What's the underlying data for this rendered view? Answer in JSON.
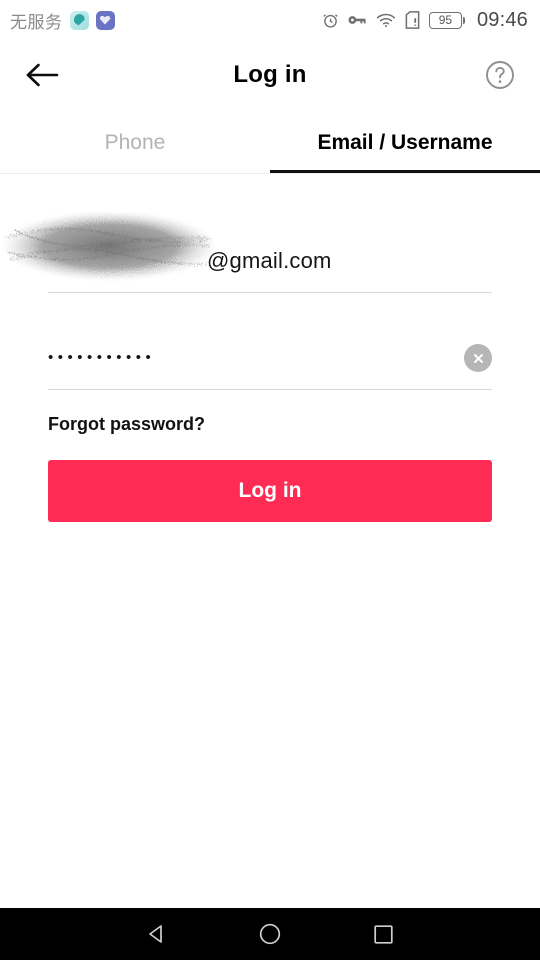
{
  "status_bar": {
    "carrier": "无服务",
    "app_icons": [
      "teal-app-icon",
      "blue-heart-app-icon"
    ],
    "icons": [
      "alarm-icon",
      "vpn-key-icon",
      "wifi-icon",
      "sim-card-alert-icon"
    ],
    "battery_level": "95",
    "time": "09:46"
  },
  "header": {
    "back_icon": "back-arrow-icon",
    "title": "Log in",
    "help_icon": "help-circle-icon"
  },
  "tabs": [
    {
      "label": "Phone",
      "active": false
    },
    {
      "label": "Email / Username",
      "active": true
    }
  ],
  "form": {
    "email": {
      "value": "@gmail.com",
      "redacted": true,
      "redaction_note": "username-redacted-scribble"
    },
    "password": {
      "value": "•••••••••••",
      "mask_count": 11,
      "clear_icon": "clear-circle-x-icon"
    },
    "forgot_password_label": "Forgot password?",
    "login_button_label": "Log in"
  },
  "nav_bar": {
    "back_icon": "nav-back-triangle-icon",
    "home_icon": "nav-home-circle-icon",
    "recents_icon": "nav-recents-square-icon"
  },
  "colors": {
    "accent": "#fe2c55",
    "active_tab": "#000000",
    "inactive_tab": "#b3b3b3",
    "nav_bar_bg": "#000000"
  }
}
